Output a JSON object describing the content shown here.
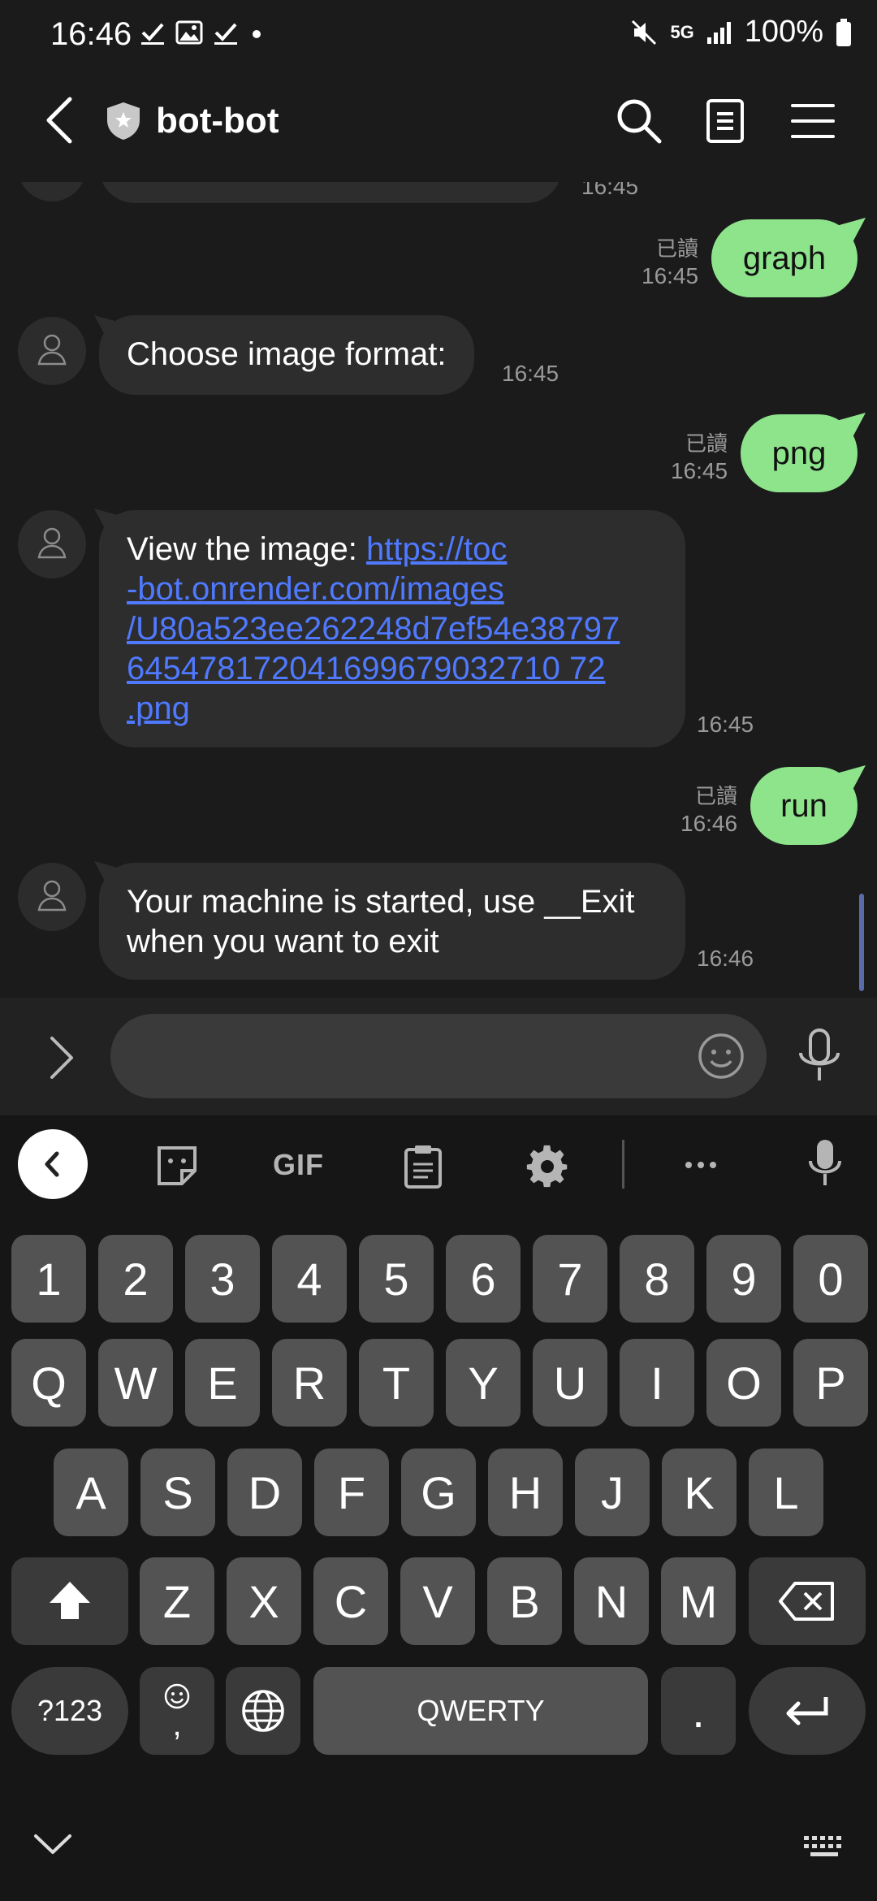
{
  "status_bar": {
    "time": "16:46",
    "network": "5G",
    "battery": "100%"
  },
  "header": {
    "title": "bot-bot",
    "icons": [
      "back-icon",
      "shield-icon",
      "search-icon",
      "notes-icon",
      "menu-icon"
    ]
  },
  "messages": [
    {
      "direction": "out",
      "text": "graph",
      "read": "已讀",
      "time": "16:45"
    },
    {
      "direction": "in",
      "text": "Choose image format:",
      "time": "16:45"
    },
    {
      "direction": "out",
      "text": "png",
      "read": "已讀",
      "time": "16:45"
    },
    {
      "direction": "in",
      "prefix": "View the image: ",
      "link_lines": [
        "https://toc",
        "-bot.onrender.com/images",
        "/U80a523ee262248d7ef54e38797",
        "645478172041699679032710 72",
        ".png"
      ],
      "time": "16:45"
    },
    {
      "direction": "out",
      "text": "run",
      "read": "已讀",
      "time": "16:46"
    },
    {
      "direction": "in",
      "lines": [
        "Your machine is started, use __Exit",
        "when you want to exit"
      ],
      "time": "16:46"
    }
  ],
  "partial_top": {
    "time": "16:45"
  },
  "input": {
    "placeholder": ""
  },
  "keyboard": {
    "toolbar": {
      "gif": "GIF"
    },
    "row_numbers": [
      "1",
      "2",
      "3",
      "4",
      "5",
      "6",
      "7",
      "8",
      "9",
      "0"
    ],
    "row_1": [
      "Q",
      "W",
      "E",
      "R",
      "T",
      "Y",
      "U",
      "I",
      "O",
      "P"
    ],
    "row_2": [
      "A",
      "S",
      "D",
      "F",
      "G",
      "H",
      "J",
      "K",
      "L"
    ],
    "row_3": [
      "Z",
      "X",
      "C",
      "V",
      "B",
      "N",
      "M"
    ],
    "symbols_key": "?123",
    "comma_key": ",",
    "space_key": "QWERTY",
    "period_key": "."
  },
  "colors": {
    "background": "#1b1b1b",
    "incoming_bubble": "#2d2d2d",
    "outgoing_bubble": "#8de48b",
    "link": "#4f79ff"
  }
}
